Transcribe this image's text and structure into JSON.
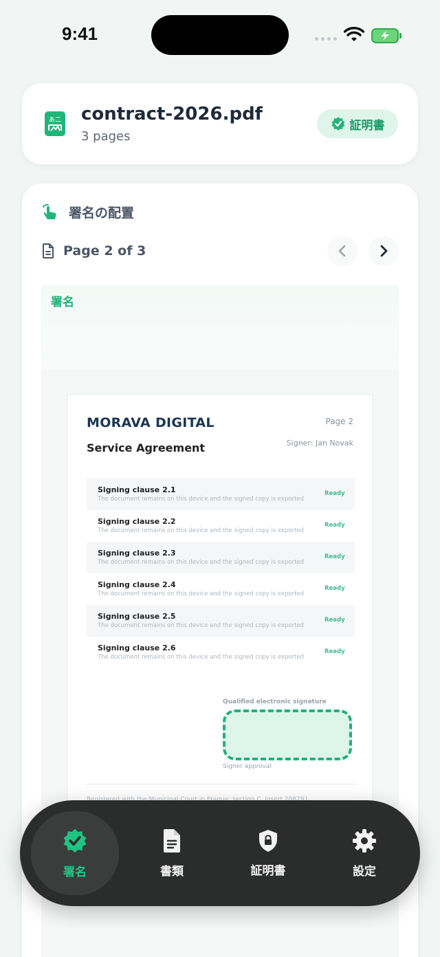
{
  "status_bar": {
    "time": "9:41"
  },
  "file": {
    "name": "contract-2026.pdf",
    "pages": "3 pages",
    "badge_label": "証明書"
  },
  "placement": {
    "title": "署名の配置",
    "page_label": "Page 2 of 3",
    "preview_label": "署名"
  },
  "document": {
    "company": "MORAVA DIGITAL",
    "page_no": "Page  2",
    "title": "Service Agreement",
    "signer": "Signer: Jan Novak",
    "clauses": [
      {
        "title": "Signing clause 2.1",
        "desc": "The document remains on this device and the signed copy is exported",
        "status": "Ready"
      },
      {
        "title": "Signing clause 2.2",
        "desc": "The document remains on this device and the signed copy is exported",
        "status": "Ready"
      },
      {
        "title": "Signing clause 2.3",
        "desc": "The document remains on this device and the signed copy is exported",
        "status": "Ready"
      },
      {
        "title": "Signing clause 2.4",
        "desc": "The document remains on this device and the signed copy is exported",
        "status": "Ready"
      },
      {
        "title": "Signing clause 2.5",
        "desc": "The document remains on this device and the signed copy is exported",
        "status": "Ready"
      },
      {
        "title": "Signing clause 2.6",
        "desc": "The document remains on this device and the signed copy is exported",
        "status": "Ready"
      }
    ],
    "signature_label": "Qualified electronic signature",
    "signature_sub": "Signer approval",
    "footer": "Registered with the Municipal Court in Prague, section C, insert 208791"
  },
  "tabs": [
    {
      "label": "署名",
      "icon": "verified-badge-icon",
      "active": true
    },
    {
      "label": "書類",
      "icon": "document-icon",
      "active": false
    },
    {
      "label": "証明書",
      "icon": "lock-shield-icon",
      "active": false
    },
    {
      "label": "設定",
      "icon": "gear-icon",
      "active": false
    }
  ],
  "colors": {
    "accent": "#1fb67a",
    "tab_bar": "#2b2c2c",
    "background": "#f1f6f4"
  }
}
